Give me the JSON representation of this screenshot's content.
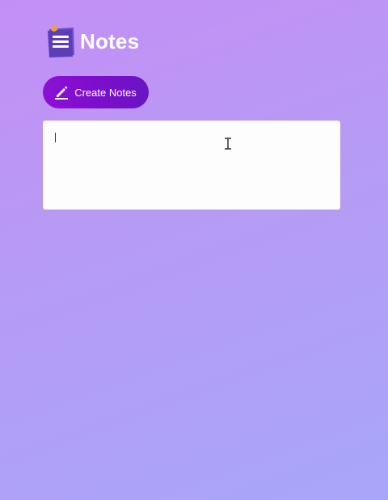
{
  "app": {
    "title": "Notes",
    "icon": "notepad-icon"
  },
  "toolbar": {
    "create_label": "Create Notes",
    "create_icon": "pencil-icon"
  },
  "note": {
    "value": "",
    "placeholder": ""
  },
  "colors": {
    "background_start": "#c38ff6",
    "background_end": "#a8a6f8",
    "button": "#7a0ecb",
    "note_bg": "#fdfdfd"
  }
}
